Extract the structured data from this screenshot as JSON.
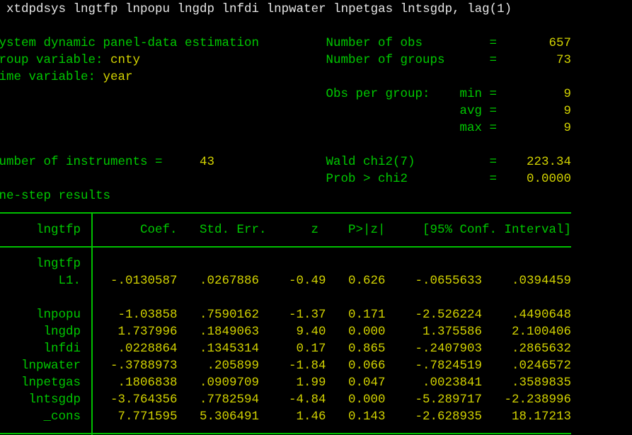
{
  "command": ". xtdpdsys lngtfp lnpopu lngdp lnfdi lnpwater lnpetgas lntsgdp, lag(1)",
  "header": {
    "title": "System dynamic panel-data estimation",
    "group_var_label": "Group variable: ",
    "group_var": "cnty",
    "time_var_label": "Time variable: ",
    "time_var": "year",
    "n_obs_label": "Number of obs",
    "n_obs": "657",
    "n_groups_label": "Number of groups",
    "n_groups": "73",
    "obs_per_group_label": "Obs per group:",
    "min_label": "min",
    "min": "9",
    "avg_label": "avg",
    "avg": "9",
    "max_label": "max",
    "max": "9",
    "instruments_label": "Number of instruments =",
    "instruments": "43",
    "wald_label": "Wald chi2(7)",
    "wald": "223.34",
    "prob_label": "Prob > chi2",
    "prob": "0.0000",
    "eq": "=",
    "results_label": "One-step results"
  },
  "table": {
    "columns": [
      "lngtfp",
      "Coef.",
      "Std. Err.",
      "z",
      "P>|z|",
      "[95% Conf. Interval]"
    ],
    "rows": [
      {
        "label": "lngtfp",
        "values": []
      },
      {
        "label": "L1.",
        "values": [
          "-.0130587",
          ".0267886",
          "-0.49",
          "0.626",
          "-.0655633",
          ".0394459"
        ]
      },
      {
        "label": "",
        "values": []
      },
      {
        "label": "lnpopu",
        "values": [
          "-1.03858",
          ".7590162",
          "-1.37",
          "0.171",
          "-2.526224",
          ".4490648"
        ]
      },
      {
        "label": "lngdp",
        "values": [
          "1.737996",
          ".1849063",
          "9.40",
          "0.000",
          "1.375586",
          "2.100406"
        ]
      },
      {
        "label": "lnfdi",
        "values": [
          ".0228864",
          ".1345314",
          "0.17",
          "0.865",
          "-.2407903",
          ".2865632"
        ]
      },
      {
        "label": "lnpwater",
        "values": [
          "-.3788973",
          ".205899",
          "-1.84",
          "0.066",
          "-.7824519",
          ".0246572"
        ]
      },
      {
        "label": "lnpetgas",
        "values": [
          ".1806838",
          ".0909709",
          "1.99",
          "0.047",
          ".0023841",
          ".3589835"
        ]
      },
      {
        "label": "lntsgdp",
        "values": [
          "-3.764356",
          ".7782594",
          "-4.84",
          "0.000",
          "-5.289717",
          "-2.238996"
        ]
      },
      {
        "label": "_cons",
        "values": [
          "7.771595",
          "5.306491",
          "1.46",
          "0.143",
          "-2.628935",
          "18.17213"
        ]
      }
    ]
  },
  "colors": {
    "green": "#00c800",
    "yellow": "#d2d200",
    "white": "#e6e6e6",
    "background": "#000000"
  }
}
